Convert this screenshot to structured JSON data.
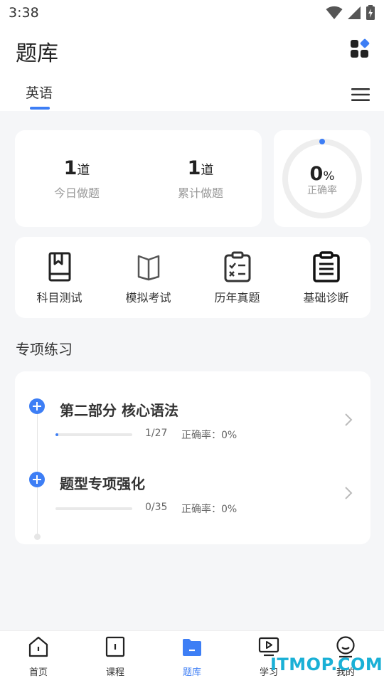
{
  "status": {
    "time": "3:38"
  },
  "header": {
    "title": "题库",
    "tab": "英语"
  },
  "stats": {
    "today": {
      "num": "1",
      "unit": "道",
      "label": "今日做题"
    },
    "total": {
      "num": "1",
      "unit": "道",
      "label": "累计做题"
    },
    "rate": {
      "num": "0",
      "pct": "%",
      "label": "正确率",
      "value": 0
    }
  },
  "tools": [
    {
      "label": "科目测试"
    },
    {
      "label": "模拟考试"
    },
    {
      "label": "历年真题"
    },
    {
      "label": "基础诊断"
    }
  ],
  "section": {
    "title": "专项练习"
  },
  "practice": [
    {
      "title": "第二部分 核心语法",
      "count": "1/27",
      "rate": "正确率：0%",
      "progress": 0.037
    },
    {
      "title": "题型专项强化",
      "count": "0/35",
      "rate": "正确率：0%",
      "progress": 0
    }
  ],
  "nav": [
    {
      "label": "首页"
    },
    {
      "label": "课程"
    },
    {
      "label": "题库"
    },
    {
      "label": "学习"
    },
    {
      "label": "我的"
    }
  ],
  "watermark": "ITMOP.COM",
  "colors": {
    "accent": "#3d7ef5"
  }
}
